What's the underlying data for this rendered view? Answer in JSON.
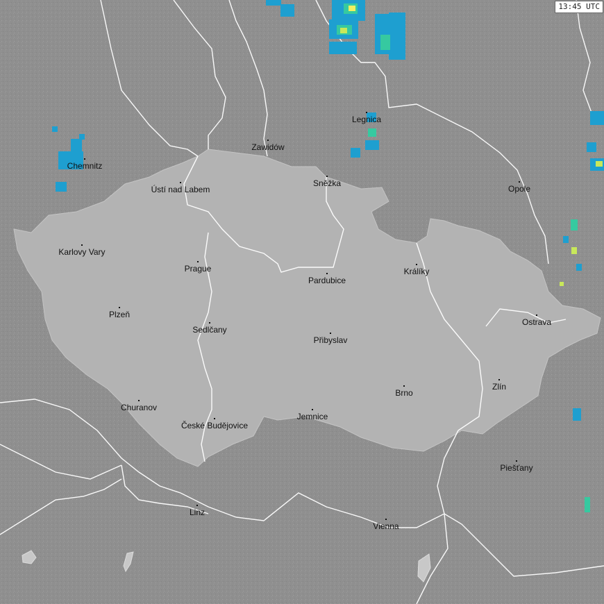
{
  "map": {
    "timestamp": "13:45 UTC",
    "colors": {
      "background_land": "#8f8f8f",
      "highlighted_country": "#b3b3b3",
      "borders": "#ffffff",
      "lakes": "#c8c8c8",
      "radar_low": "#1e9fd0",
      "radar_mid": "#36c9a0",
      "radar_high": "#c8e85a",
      "radar_peak": "#f0f060"
    },
    "cities": [
      {
        "name": "Legnica"
      },
      {
        "name": "Zawidów"
      },
      {
        "name": "Chemnitz"
      },
      {
        "name": "Ústí nad Labem"
      },
      {
        "name": "Sněžka"
      },
      {
        "name": "Opole"
      },
      {
        "name": "Karlovy Vary"
      },
      {
        "name": "Prague"
      },
      {
        "name": "Pardubice"
      },
      {
        "name": "Králíky"
      },
      {
        "name": "Plzeň"
      },
      {
        "name": "Ostrava"
      },
      {
        "name": "Sedlčany"
      },
      {
        "name": "Přibyslav"
      },
      {
        "name": "Zlín"
      },
      {
        "name": "Brno"
      },
      {
        "name": "Churanov"
      },
      {
        "name": "Jemnice"
      },
      {
        "name": "České Budějovice"
      },
      {
        "name": "Piešťany"
      },
      {
        "name": "Linz"
      },
      {
        "name": "Vienna"
      }
    ]
  }
}
